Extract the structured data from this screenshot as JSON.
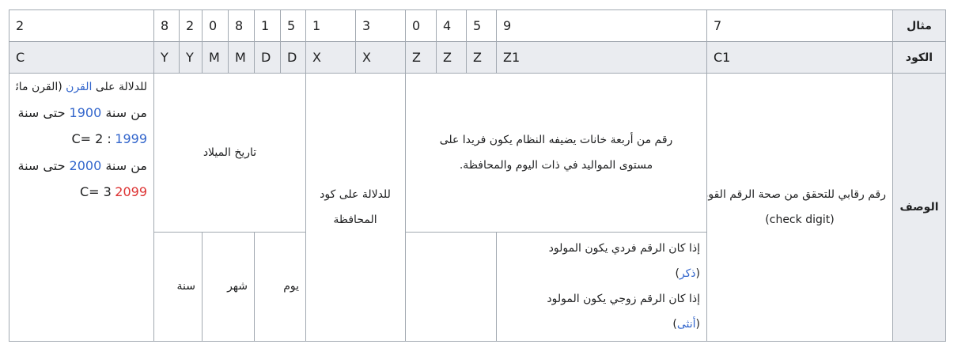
{
  "headers": {
    "example": "مثال",
    "code": "الكود",
    "description": "الوصف"
  },
  "example_values": [
    "7",
    "9",
    "5",
    "4",
    "0",
    "3",
    "1",
    "5",
    "1",
    "8",
    "0",
    "2",
    "8",
    "2"
  ],
  "codes": [
    "C1",
    "Z1",
    "Z",
    "Z",
    "Z",
    "X",
    "X",
    "D",
    "D",
    "M",
    "M",
    "Y",
    "Y",
    "C"
  ],
  "descriptions": {
    "check_digit": {
      "text": "رقم رقابي للتحقق من صحة الرقم القومي",
      "en": "(check digit)"
    },
    "birth_seq": "رقم من أربعة خانات يضيفه النظام يكون فريدا على مستوى المواليد في ذات اليوم والمحافظة.",
    "gender": {
      "odd_prefix": "إذا كان الرقم فردي يكون المولود",
      "male": "ذكر",
      "even_prefix": "إذا كان الرقم زوجي يكون المولود",
      "female": "أنثى"
    },
    "governorate": "للدلالة على كود المحافظة",
    "birth_date": {
      "label": "تاريخ الميلاد",
      "day": "يوم",
      "month": "شهر",
      "year": "سنة"
    },
    "century": {
      "prefix": "للدلالة على",
      "link": "القرن",
      "paren": "(القرن مائة عام)",
      "from": "من سنة",
      "until": "حتى سنة",
      "y1900": "1900",
      "y1999": "1999",
      "c2": "C= 2 :",
      "y2000": "2000",
      "y2099": "2099",
      "c3": "C= 3"
    }
  }
}
